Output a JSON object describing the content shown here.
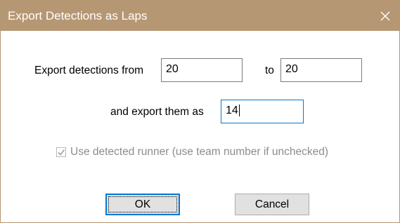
{
  "window": {
    "title": "Export Detections as Laps",
    "close_icon": "close-icon"
  },
  "form": {
    "from_label": "Export detections from",
    "from_value": "20",
    "to_label": "to",
    "to_value": "20",
    "as_label": "and export them as",
    "as_value": "14",
    "checkbox_label": "Use detected runner (use team number if unchecked)",
    "checkbox_checked": true,
    "checkbox_disabled": true
  },
  "buttons": {
    "ok_label": "OK",
    "cancel_label": "Cancel"
  },
  "colors": {
    "titlebar": "#b69773",
    "focus": "#0078d7",
    "disabled_text": "#8c8c8c"
  }
}
